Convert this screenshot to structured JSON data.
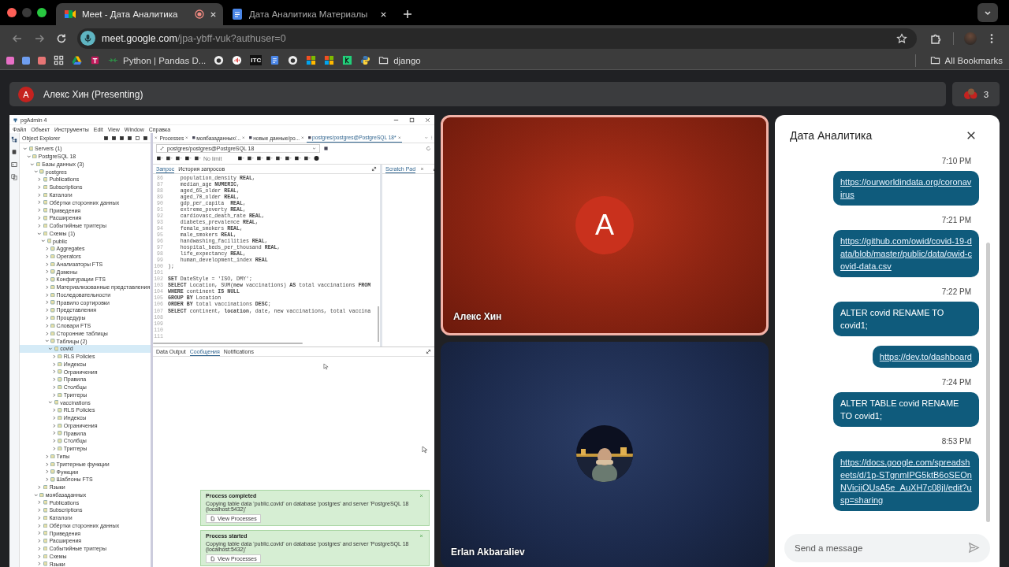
{
  "browser": {
    "tabs": [
      {
        "title": "Meet - Дата Аналитика",
        "kind": "meet",
        "recording": true,
        "selected": true
      },
      {
        "title": "Дата Аналитика Материалы",
        "kind": "docs",
        "recording": false,
        "selected": false
      }
    ],
    "url": {
      "host": "meet.google.com",
      "path": "/jpa-ybff-vuk?authuser=0"
    },
    "bookmarks": [
      {
        "kind": "tile",
        "color": "#e86fc6"
      },
      {
        "kind": "tile",
        "color": "#6f9ef0"
      },
      {
        "kind": "tile",
        "color": "#e77575"
      },
      {
        "kind": "apps"
      },
      {
        "kind": "drive"
      },
      {
        "kind": "tool"
      },
      {
        "kind": "site",
        "label": "Python | Pandas D..."
      },
      {
        "kind": "github"
      },
      {
        "kind": "podcast"
      },
      {
        "kind": "badge",
        "label": "ITC"
      },
      {
        "kind": "docs"
      },
      {
        "kind": "github"
      },
      {
        "kind": "windows"
      },
      {
        "kind": "windows"
      },
      {
        "kind": "green"
      },
      {
        "kind": "python"
      },
      {
        "kind": "folder",
        "label": "django"
      }
    ],
    "all_bookmarks": "All Bookmarks"
  },
  "meet": {
    "presenter_initial": "A",
    "presenting": "Алекс Хин (Presenting)",
    "participant_count": "3"
  },
  "pgadmin": {
    "title": "pgAdmin 4",
    "menu": [
      "Файл",
      "Объект",
      "Инструменты",
      "Edit",
      "View",
      "Window",
      "Справка"
    ],
    "explorer_title": "Object Explorer",
    "tree": [
      {
        "label": "Servers (1)",
        "expanded": true,
        "selected": false,
        "children": [
          {
            "label": "PostgreSQL 18",
            "expanded": true,
            "selected": false,
            "children": [
              {
                "label": "Базы данных (3)",
                "expanded": true,
                "selected": false,
                "children": [
                  {
                    "label": "postgres",
                    "expanded": true,
                    "selected": false,
                    "children": [
                      {
                        "label": "Publications",
                        "expanded": false,
                        "selected": false
                      },
                      {
                        "label": "Subscriptions",
                        "expanded": false,
                        "selected": false
                      },
                      {
                        "label": "Каталоги",
                        "expanded": false,
                        "selected": false
                      },
                      {
                        "label": "Обёртки сторонних данных",
                        "expanded": false,
                        "selected": false
                      },
                      {
                        "label": "Приведения",
                        "expanded": false,
                        "selected": false
                      },
                      {
                        "label": "Расширения",
                        "expanded": false,
                        "selected": false
                      },
                      {
                        "label": "Событийные триггеры",
                        "expanded": false,
                        "selected": false
                      },
                      {
                        "label": "Схемы (1)",
                        "expanded": true,
                        "selected": false,
                        "children": [
                          {
                            "label": "public",
                            "expanded": true,
                            "selected": false,
                            "children": [
                              {
                                "label": "Aggregates",
                                "expanded": false,
                                "selected": false
                              },
                              {
                                "label": "Operators",
                                "expanded": false,
                                "selected": false
                              },
                              {
                                "label": "Анализаторы FTS",
                                "expanded": false,
                                "selected": false
                              },
                              {
                                "label": "Домены",
                                "expanded": false,
                                "selected": false
                              },
                              {
                                "label": "Конфигурации FTS",
                                "expanded": false,
                                "selected": false
                              },
                              {
                                "label": "Материализованные представления",
                                "expanded": false,
                                "selected": false
                              },
                              {
                                "label": "Последовательности",
                                "expanded": false,
                                "selected": false
                              },
                              {
                                "label": "Правило сортировки",
                                "expanded": false,
                                "selected": false
                              },
                              {
                                "label": "Представления",
                                "expanded": false,
                                "selected": false
                              },
                              {
                                "label": "Процедуры",
                                "expanded": false,
                                "selected": false
                              },
                              {
                                "label": "Словари FTS",
                                "expanded": false,
                                "selected": false
                              },
                              {
                                "label": "Сторонние таблицы",
                                "expanded": false,
                                "selected": false
                              },
                              {
                                "label": "Таблицы (2)",
                                "expanded": true,
                                "selected": false,
                                "children": [
                                  {
                                    "label": "covid",
                                    "expanded": true,
                                    "selected": true,
                                    "children": [
                                      {
                                        "label": "RLS Policies",
                                        "expanded": false,
                                        "selected": false
                                      },
                                      {
                                        "label": "Индексы",
                                        "expanded": false,
                                        "selected": false
                                      },
                                      {
                                        "label": "Ограничения",
                                        "expanded": false,
                                        "selected": false
                                      },
                                      {
                                        "label": "Правила",
                                        "expanded": false,
                                        "selected": false
                                      },
                                      {
                                        "label": "Столбцы",
                                        "expanded": false,
                                        "selected": false
                                      },
                                      {
                                        "label": "Триггеры",
                                        "expanded": false,
                                        "selected": false
                                      }
                                    ]
                                  },
                                  {
                                    "label": "vaccinations",
                                    "expanded": true,
                                    "selected": false,
                                    "children": [
                                      {
                                        "label": "RLS Policies",
                                        "expanded": false,
                                        "selected": false
                                      },
                                      {
                                        "label": "Индексы",
                                        "expanded": false,
                                        "selected": false
                                      },
                                      {
                                        "label": "Ограничения",
                                        "expanded": false,
                                        "selected": false
                                      },
                                      {
                                        "label": "Правила",
                                        "expanded": false,
                                        "selected": false
                                      },
                                      {
                                        "label": "Столбцы",
                                        "expanded": false,
                                        "selected": false
                                      },
                                      {
                                        "label": "Триггеры",
                                        "expanded": false,
                                        "selected": false
                                      }
                                    ]
                                  }
                                ]
                              },
                              {
                                "label": "Типы",
                                "expanded": false,
                                "selected": false
                              },
                              {
                                "label": "Триггерные функции",
                                "expanded": false,
                                "selected": false
                              },
                              {
                                "label": "Функции",
                                "expanded": false,
                                "selected": false
                              },
                              {
                                "label": "Шаблоны FTS",
                                "expanded": false,
                                "selected": false
                              }
                            ]
                          }
                        ]
                      },
                      {
                        "label": "Языки",
                        "expanded": false,
                        "selected": false
                      }
                    ]
                  },
                  {
                    "label": "моябазаданных",
                    "expanded": true,
                    "selected": false,
                    "children": [
                      {
                        "label": "Publications",
                        "expanded": false,
                        "selected": false
                      },
                      {
                        "label": "Subscriptions",
                        "expanded": false,
                        "selected": false
                      },
                      {
                        "label": "Каталоги",
                        "expanded": false,
                        "selected": false
                      },
                      {
                        "label": "Обёртки сторонних данных",
                        "expanded": false,
                        "selected": false
                      },
                      {
                        "label": "Приведения",
                        "expanded": false,
                        "selected": false
                      },
                      {
                        "label": "Расширения",
                        "expanded": false,
                        "selected": false
                      },
                      {
                        "label": "Событийные триггеры",
                        "expanded": false,
                        "selected": false
                      },
                      {
                        "label": "Схемы",
                        "expanded": false,
                        "selected": false
                      },
                      {
                        "label": "Языки",
                        "expanded": false,
                        "selected": false
                      }
                    ]
                  }
                ]
              }
            ]
          }
        ]
      }
    ],
    "doc_tabs": [
      {
        "label": "Processes",
        "kind": "plain",
        "selected": false
      },
      {
        "label": "моябазаданных/...",
        "kind": "db",
        "selected": false
      },
      {
        "label": "новые данные/po...",
        "kind": "db",
        "selected": false
      },
      {
        "label": "postgres/postgres@PostgreSQL 18*",
        "kind": "db",
        "selected": true
      }
    ],
    "connection": "postgres/postgres@PostgreSQL 18",
    "row_limit": "No limit",
    "query_tabs": [
      {
        "label": "Запрос",
        "selected": true
      },
      {
        "label": "История запросов",
        "selected": false
      }
    ],
    "scratch_pad": "Scratch Pad",
    "code": [
      {
        "no": "86",
        "code": "    population_density **REAL**,"
      },
      {
        "no": "87",
        "code": "    median_age **NUMERIC**,"
      },
      {
        "no": "88",
        "code": "    aged_65_older **REAL**,"
      },
      {
        "no": "89",
        "code": "    aged_70_older **REAL**,"
      },
      {
        "no": "90",
        "code": "    gdp_per_capita  **REAL**,"
      },
      {
        "no": "91",
        "code": "    extreme_poverty **REAL**,"
      },
      {
        "no": "92",
        "code": "    cardiovasc_death_rate **REAL**,"
      },
      {
        "no": "93",
        "code": "    diabetes_prevalence **REAL**,"
      },
      {
        "no": "94",
        "code": "    female_smokers **REAL**,"
      },
      {
        "no": "95",
        "code": "    male_smokers **REAL**,"
      },
      {
        "no": "96",
        "code": "    handwashing_facilities **REAL**,"
      },
      {
        "no": "97",
        "code": "    hospital_beds_per_thousand **REAL**,"
      },
      {
        "no": "98",
        "code": "    life_expectancy **REAL**,"
      },
      {
        "no": "99",
        "code": "    human_development_index **REAL**"
      },
      {
        "no": "100",
        "code": ");"
      },
      {
        "no": "101"
      },
      {
        "no": "102",
        "code": "**SET** DateStyle = 'ISO, DMY';"
      },
      {
        "no": "103",
        "code": "**SELECT** Location, SUM(**new** vaccinations) **AS** total vaccinations **FROM**"
      },
      {
        "no": "104",
        "code": "**WHERE** continent **IS NULL**"
      },
      {
        "no": "105",
        "code": "**GROUP BY** Location"
      },
      {
        "no": "106",
        "code": "**ORDER BY** total vaccinations **DESC**;"
      },
      {
        "no": "107",
        "code": "**SELECT** continent, **location**, date, new vaccinations, total vaccina"
      },
      {
        "no": "108"
      },
      {
        "no": "109"
      },
      {
        "no": "110"
      },
      {
        "no": "111"
      }
    ],
    "result_tabs": [
      {
        "label": "Data Output",
        "selected": false
      },
      {
        "label": "Сообщения",
        "selected": true
      },
      {
        "label": "Notifications",
        "selected": false
      }
    ],
    "toasts": [
      {
        "title": "Process completed",
        "message": "Copying table data 'public.covid' on database 'postgres' and server 'PostgreSQL 18 (localhost:5432)'",
        "action": "View Processes"
      },
      {
        "title": "Process started",
        "message": "Copying table data 'public.covid' on database 'postgres' and server 'PostgreSQL 18 (localhost:5432)'",
        "action": "View Processes"
      }
    ]
  },
  "tiles": [
    {
      "name": "Алекс Хин",
      "kind": "initial",
      "initial": "A",
      "speaking": true
    },
    {
      "name": "Erlan Akbaraliev",
      "speaking": false
    }
  ],
  "chat": {
    "title": "Дата Аналитика",
    "groups": [
      {
        "time": "7:10 PM",
        "messages": [
          {
            "kind": "link",
            "text": "https://ourworldindata.org/coronavirus"
          }
        ]
      },
      {
        "time": "7:21 PM",
        "messages": [
          {
            "kind": "link",
            "text": "https://github.com/owid/covid-19-data/blob/master/public/data/owid-covid-data.csv"
          }
        ]
      },
      {
        "time": "7:22 PM",
        "messages": [
          {
            "kind": "text",
            "text": "ALTER covid RENAME TO covid1;"
          },
          {
            "kind": "link",
            "text": "https://dev.to/dashboard"
          }
        ]
      },
      {
        "time": "7:24 PM",
        "messages": [
          {
            "kind": "text",
            "text": "ALTER TABLE covid RENAME TO covid1;"
          }
        ]
      },
      {
        "time": "8:53 PM",
        "messages": [
          {
            "kind": "link",
            "text": "https://docs.google.com/spreadsheets/d/1p-STgnmIPG5ktB6oSEOnNVicjjOUsA5e_AuXH7c08jI/edit?usp=sharing"
          }
        ]
      }
    ],
    "input_placeholder": "Send a message"
  }
}
